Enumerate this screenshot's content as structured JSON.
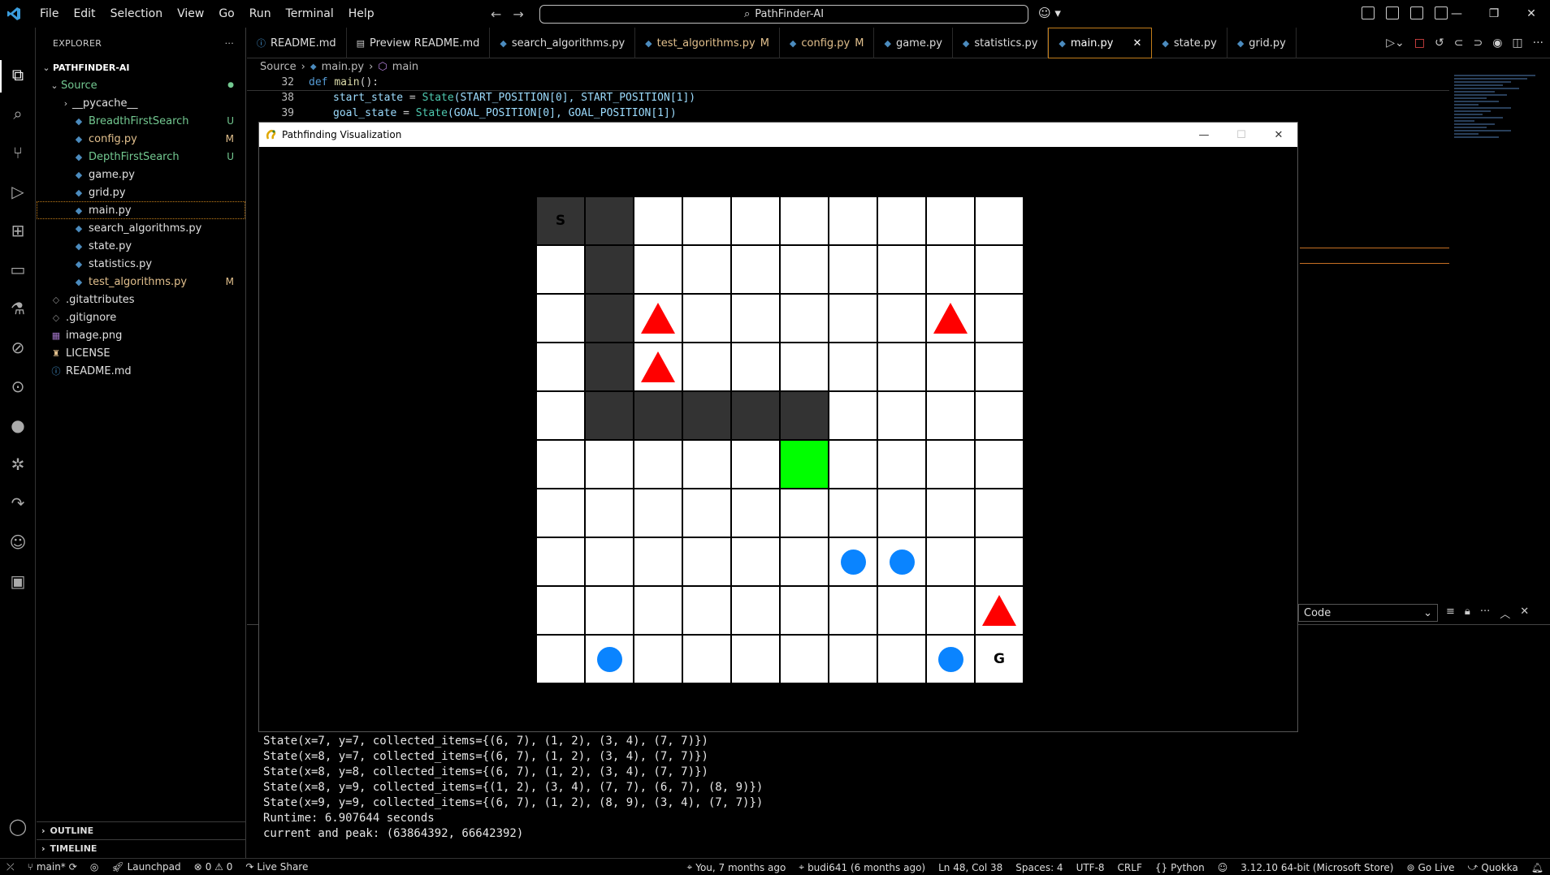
{
  "titlebar": {
    "menu": [
      "File",
      "Edit",
      "Selection",
      "View",
      "Go",
      "Run",
      "Terminal",
      "Help"
    ],
    "search_text": "PathFinder-AI"
  },
  "explorer": {
    "title": "EXPLORER",
    "root": "PATHFINDER-AI",
    "folder": "Source",
    "items": [
      {
        "label": "__pycache__",
        "badge": ""
      },
      {
        "label": "BreadthFirstSearch",
        "badge": "U"
      },
      {
        "label": "config.py",
        "badge": "M"
      },
      {
        "label": "DepthFirstSearch",
        "badge": "U"
      },
      {
        "label": "game.py",
        "badge": ""
      },
      {
        "label": "grid.py",
        "badge": ""
      },
      {
        "label": "main.py",
        "badge": ""
      },
      {
        "label": "search_algorithms.py",
        "badge": ""
      },
      {
        "label": "state.py",
        "badge": ""
      },
      {
        "label": "statistics.py",
        "badge": ""
      },
      {
        "label": "test_algorithms.py",
        "badge": "M"
      }
    ],
    "root_files": [
      ".gitattributes",
      ".gitignore",
      "image.png",
      "LICENSE",
      "README.md"
    ],
    "outline": "OUTLINE",
    "timeline": "TIMELINE"
  },
  "tabs": [
    {
      "label": "README.md",
      "mod": ""
    },
    {
      "label": "Preview README.md",
      "mod": ""
    },
    {
      "label": "search_algorithms.py",
      "mod": ""
    },
    {
      "label": "test_algorithms.py",
      "mod": "M"
    },
    {
      "label": "config.py",
      "mod": "M"
    },
    {
      "label": "game.py",
      "mod": ""
    },
    {
      "label": "statistics.py",
      "mod": ""
    },
    {
      "label": "main.py",
      "mod": ""
    },
    {
      "label": "state.py",
      "mod": ""
    },
    {
      "label": "grid.py",
      "mod": ""
    }
  ],
  "breadcrumb": {
    "folder": "Source",
    "file": "main.py",
    "symbol": "main"
  },
  "code": {
    "line32_num": "32",
    "line38_num": "38",
    "line39_num": "39",
    "line32": {
      "kw": "def",
      "fn": "main",
      "rest": "():"
    },
    "line38": {
      "var": "start_state",
      "eq": " = ",
      "cls": "State",
      "rest": "(START_POSITION[0], START_POSITION[1])"
    },
    "line39": {
      "var": "goal_state",
      "eq": " = ",
      "cls": "State",
      "rest": "(GOAL_POSITION[0], GOAL_POSITION[1])"
    }
  },
  "panel": {
    "select_value": "Code"
  },
  "terminal": [
    "State(x=7, y=7, collected_items={(6, 7), (1, 2), (3, 4), (7, 7)})",
    "State(x=8, y=7, collected_items={(6, 7), (1, 2), (3, 4), (7, 7)})",
    "State(x=8, y=8, collected_items={(6, 7), (1, 2), (3, 4), (7, 7)})",
    "State(x=8, y=9, collected_items={(1, 2), (3, 4), (7, 7), (6, 7), (8, 9)})",
    "State(x=9, y=9, collected_items={(6, 7), (1, 2), (8, 9), (3, 4), (7, 7)})",
    "Runtime: 6.907644 seconds",
    "current and peak: (63864392, 66642392)"
  ],
  "pygame": {
    "title": "Pathfinding Visualization",
    "start_label": "S",
    "goal_label": "G",
    "grid": [
      [
        "S",
        "W",
        ".",
        ".",
        ".",
        ".",
        ".",
        ".",
        ".",
        "."
      ],
      [
        ".",
        "W",
        ".",
        ".",
        ".",
        ".",
        ".",
        ".",
        ".",
        "."
      ],
      [
        ".",
        "W",
        "T",
        ".",
        ".",
        ".",
        ".",
        ".",
        "T",
        "."
      ],
      [
        ".",
        "W",
        "T",
        ".",
        ".",
        ".",
        ".",
        ".",
        ".",
        "."
      ],
      [
        ".",
        "W",
        "W",
        "W",
        "W",
        "W",
        ".",
        ".",
        ".",
        "."
      ],
      [
        ".",
        ".",
        ".",
        ".",
        ".",
        "A",
        ".",
        ".",
        ".",
        "."
      ],
      [
        ".",
        ".",
        ".",
        ".",
        ".",
        ".",
        ".",
        ".",
        ".",
        "."
      ],
      [
        ".",
        ".",
        ".",
        ".",
        ".",
        ".",
        "O",
        "O",
        ".",
        "."
      ],
      [
        ".",
        ".",
        ".",
        ".",
        ".",
        ".",
        ".",
        ".",
        ".",
        "T"
      ],
      [
        ".",
        "O",
        ".",
        ".",
        ".",
        ".",
        ".",
        ".",
        "O",
        "G"
      ]
    ],
    "colors": {
      "wall": "#333333",
      "agent": "#00ff00",
      "triangle": "#ff0000",
      "dot": "#0a84ff"
    }
  },
  "statusbar": {
    "branch": "main*",
    "launchpad": "Launchpad",
    "problems": "0 ⚠ 0",
    "live_share": "Live Share",
    "blame": "You, 7 months ago",
    "commit": "budi641 (6 months ago)",
    "position": "Ln 48, Col 38",
    "spaces": "Spaces: 4",
    "encoding": "UTF-8",
    "eol": "CRLF",
    "language": "Python",
    "interpreter": "3.12.10 64-bit (Microsoft Store)",
    "go_live": "Go Live",
    "quokka": "Quokka"
  }
}
